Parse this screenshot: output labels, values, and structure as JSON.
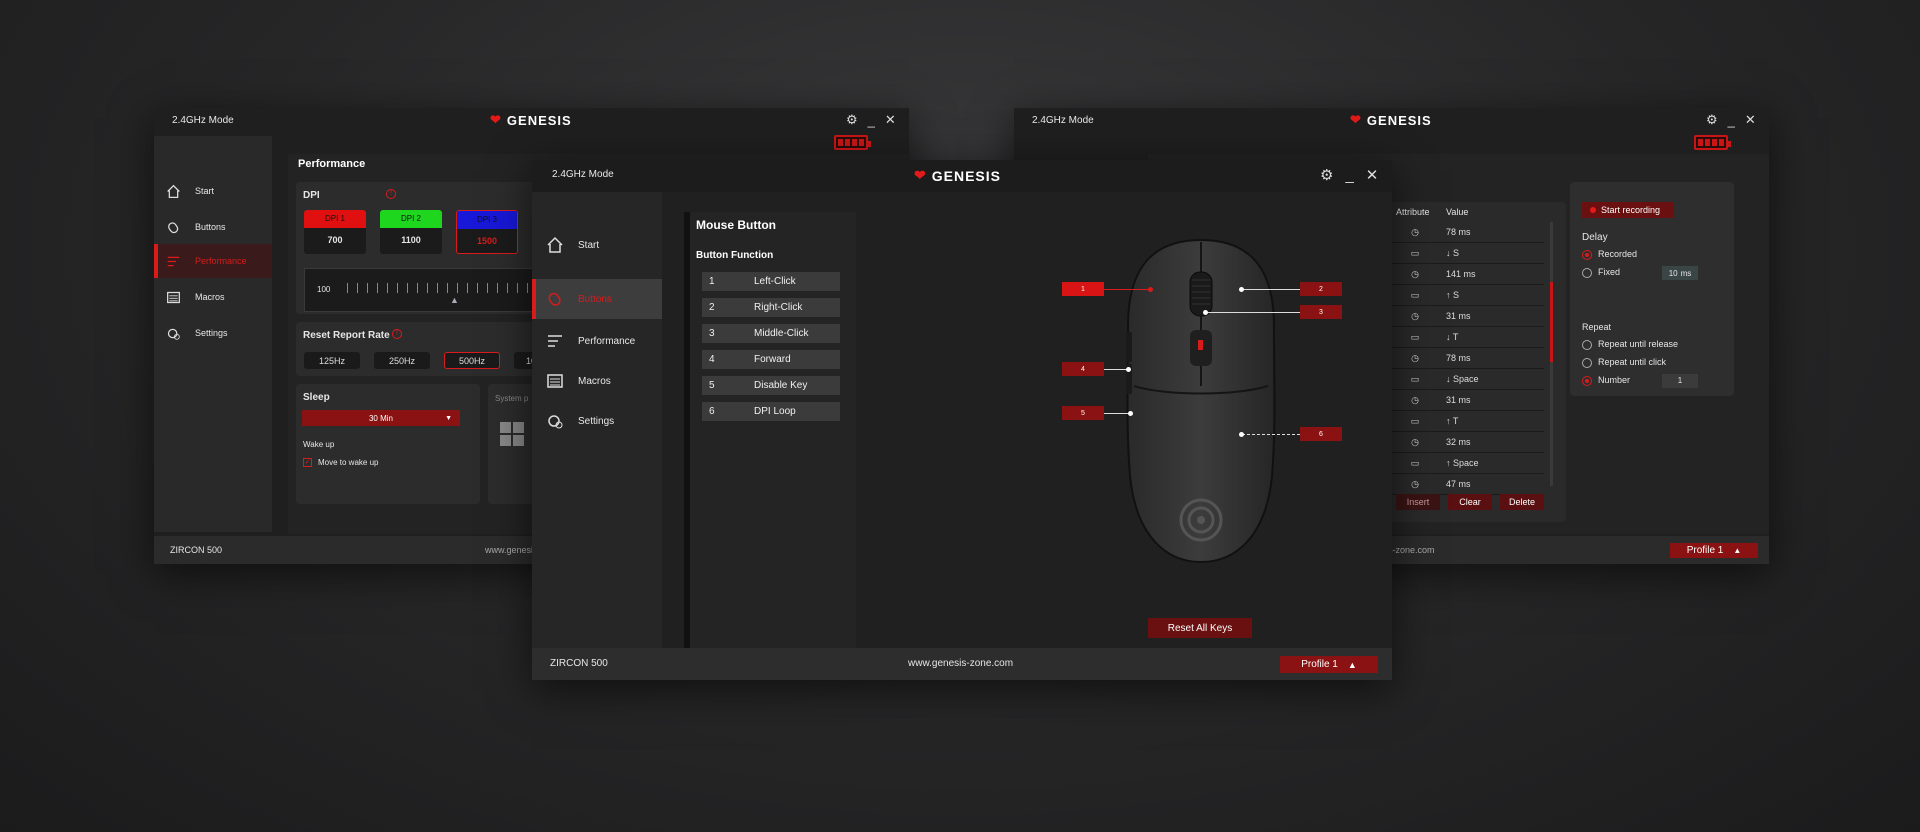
{
  "colors": {
    "accent": "#d81c1c",
    "dpi1": "#e01010",
    "dpi2": "#1ed61e",
    "dpi3": "#1818d8"
  },
  "left_window": {
    "mode": "2.4GHz Mode",
    "logo": "GENESIS",
    "nav": [
      {
        "label": "Start",
        "icon": "home-icon"
      },
      {
        "label": "Buttons",
        "icon": "mouse-icon"
      },
      {
        "label": "Performance",
        "icon": "sliders-icon",
        "active": true
      },
      {
        "label": "Macros",
        "icon": "keyboard-icon"
      },
      {
        "label": "Settings",
        "icon": "gear-icon"
      }
    ],
    "section_title": "Performance",
    "dpi": {
      "label": "DPI",
      "stages": [
        {
          "name": "DPI 1",
          "value": "700"
        },
        {
          "name": "DPI 2",
          "value": "1100"
        },
        {
          "name": "DPI 3",
          "value": "1500"
        }
      ],
      "slider_min": "100"
    },
    "report_rate": {
      "label": "Reset Report Rate",
      "options": [
        "125Hz",
        "250Hz",
        "500Hz",
        "1000Hz"
      ],
      "selected": "500Hz"
    },
    "sleep": {
      "label": "Sleep",
      "value": "30 Min",
      "wake_label": "Wake up",
      "move_to_wake": "Move to wake up"
    },
    "system_label": "System p",
    "footer_model": "ZIRCON 500",
    "footer_site": "www.genesi"
  },
  "right_window": {
    "mode": "2.4GHz Mode",
    "logo": "GENESIS",
    "columns": [
      "Attribute",
      "Value"
    ],
    "rows": [
      {
        "icon": "clock-icon",
        "value": "78 ms"
      },
      {
        "icon": "key-icon",
        "value": "↓ S"
      },
      {
        "icon": "clock-icon",
        "value": "141 ms"
      },
      {
        "icon": "key-icon",
        "value": "↑ S"
      },
      {
        "icon": "clock-icon",
        "value": "31 ms"
      },
      {
        "icon": "key-icon",
        "value": "↓ T"
      },
      {
        "icon": "clock-icon",
        "value": "78 ms"
      },
      {
        "icon": "key-icon",
        "value": "↓ Space"
      },
      {
        "icon": "clock-icon",
        "value": "31 ms"
      },
      {
        "icon": "key-icon",
        "value": "↑ T"
      },
      {
        "icon": "clock-icon",
        "value": "32 ms"
      },
      {
        "icon": "key-icon",
        "value": "↑ Space"
      },
      {
        "icon": "clock-icon",
        "value": "47 ms"
      }
    ],
    "actions": [
      "Insert",
      "Clear",
      "Delete"
    ],
    "start_recording": "Start recording",
    "delay": {
      "label": "Delay",
      "recorded": "Recorded",
      "fixed": "Fixed",
      "fixed_value": "10",
      "unit": "ms"
    },
    "repeat": {
      "label": "Repeat",
      "until_release": "Repeat until release",
      "until_click": "Repeat until click",
      "number": "Number",
      "number_value": "1"
    },
    "footer_site": "s-zone.com",
    "profile": "Profile 1"
  },
  "main_window": {
    "mode": "2.4GHz Mode",
    "logo": "GENESIS",
    "nav": [
      {
        "label": "Start",
        "icon": "home-icon"
      },
      {
        "label": "Buttons",
        "icon": "mouse-icon",
        "active": true
      },
      {
        "label": "Performance",
        "icon": "sliders-icon"
      },
      {
        "label": "Macros",
        "icon": "keyboard-icon"
      },
      {
        "label": "Settings",
        "icon": "gear-icon"
      }
    ],
    "panel_title": "Mouse Button",
    "function_title": "Button Function",
    "functions": [
      {
        "num": "1",
        "label": "Left-Click"
      },
      {
        "num": "2",
        "label": "Right-Click"
      },
      {
        "num": "3",
        "label": "Middle-Click"
      },
      {
        "num": "4",
        "label": "Forward"
      },
      {
        "num": "5",
        "label": "Disable Key"
      },
      {
        "num": "6",
        "label": "DPI Loop"
      }
    ],
    "callouts": [
      "1",
      "2",
      "3",
      "4",
      "5",
      "6"
    ],
    "reset_all": "Reset All Keys",
    "footer_model": "ZIRCON 500",
    "footer_site": "www.genesis-zone.com",
    "profile": "Profile 1"
  }
}
